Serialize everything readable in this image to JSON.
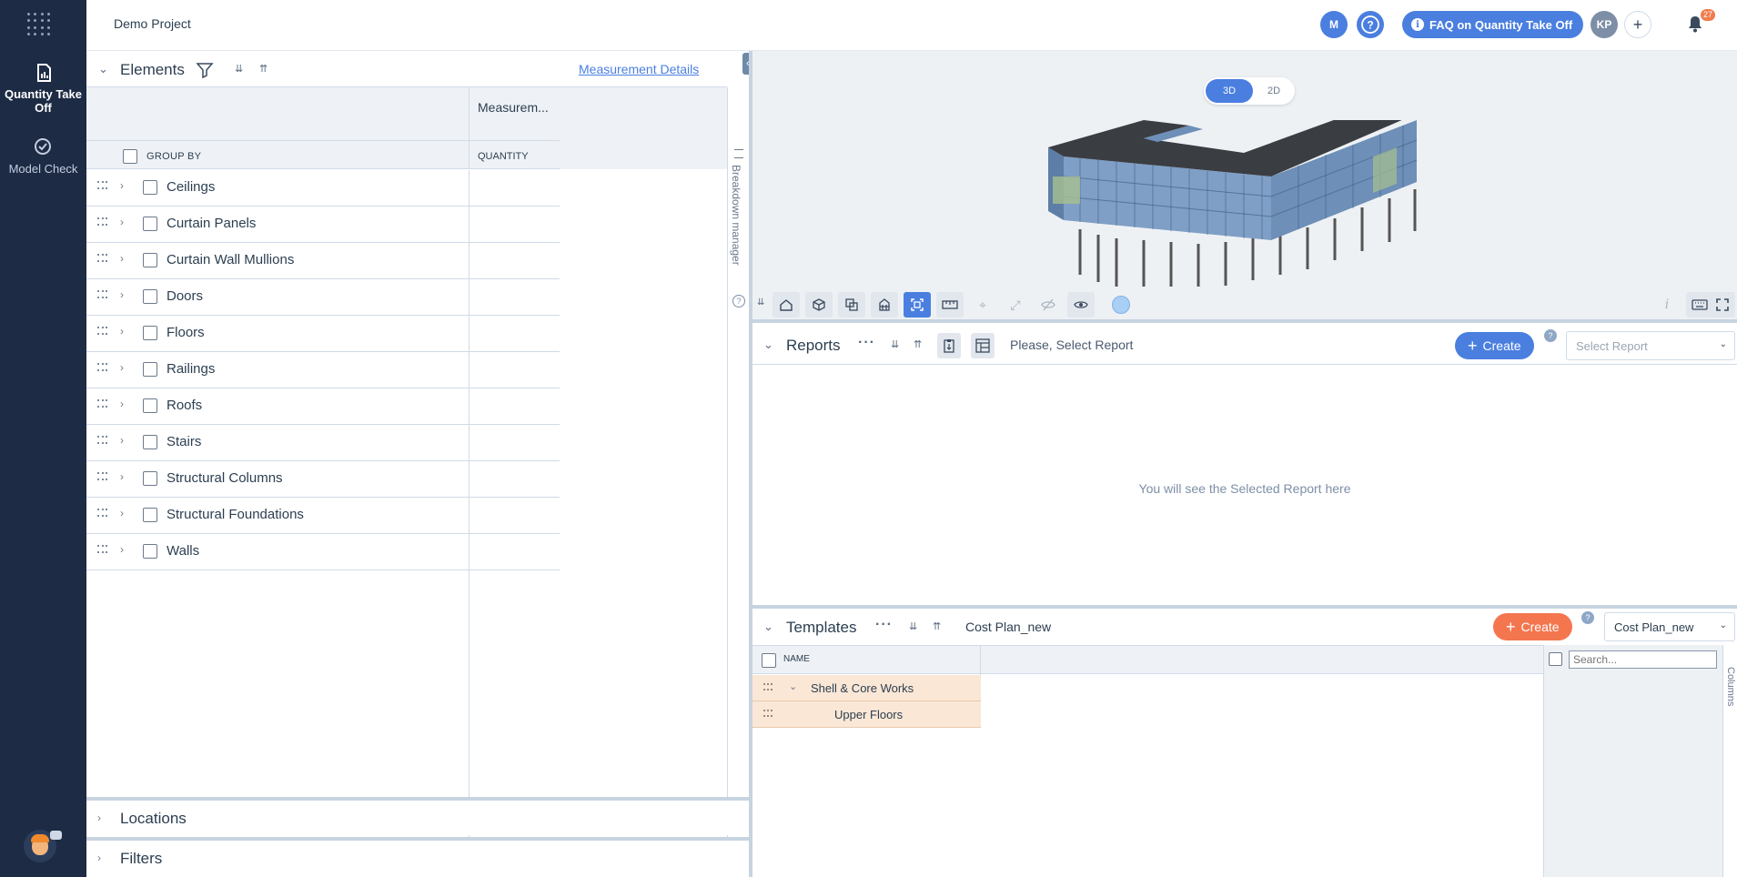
{
  "nav": {
    "items": [
      {
        "label": "Quantity Take Off",
        "icon": "quantity-takeoff-icon",
        "active": true
      },
      {
        "label": "Model Check",
        "icon": "model-check-icon",
        "active": false
      }
    ]
  },
  "topbar": {
    "project": "Demo Project",
    "user_m": "M",
    "faq_label": "FAQ on Quantity Take Off",
    "user_kp": "KP",
    "notifications": "27"
  },
  "elements": {
    "title": "Elements",
    "measurement_link": "Measurement Details",
    "measurement_col": "Measurem...",
    "groupby_label": "GROUP BY",
    "quantity_col": "QUANTITY",
    "breakdown_label": "Breakdown manager",
    "rows": [
      "Ceilings",
      "Curtain Panels",
      "Curtain Wall Mullions",
      "Doors",
      "Floors",
      "Railings",
      "Roofs",
      "Stairs",
      "Structural Columns",
      "Structural Foundations",
      "Walls"
    ]
  },
  "locations": {
    "title": "Locations"
  },
  "filters": {
    "title": "Filters"
  },
  "viewer": {
    "mode_3d": "3D",
    "mode_2d": "2D",
    "info_glyph": "i"
  },
  "reports": {
    "title": "Reports",
    "selection_text": "Please, Select Report",
    "create_label": "Create",
    "select_placeholder": "Select Report",
    "empty_message": "You will see the Selected Report here"
  },
  "templates": {
    "title": "Templates",
    "current": "Cost Plan_new",
    "create_label": "Create",
    "select_value": "Cost Plan_new",
    "name_col": "NAME",
    "rows": [
      {
        "label": "Shell & Core Works"
      },
      {
        "label": "Upper Floors"
      }
    ],
    "search_placeholder": "Search...",
    "columns_label": "Columns"
  },
  "colors": {
    "nav_bg": "#1d2b44",
    "accent_blue": "#4a7fe0",
    "accent_orange": "#f4764f",
    "row_highlight": "#fbe7d6"
  }
}
